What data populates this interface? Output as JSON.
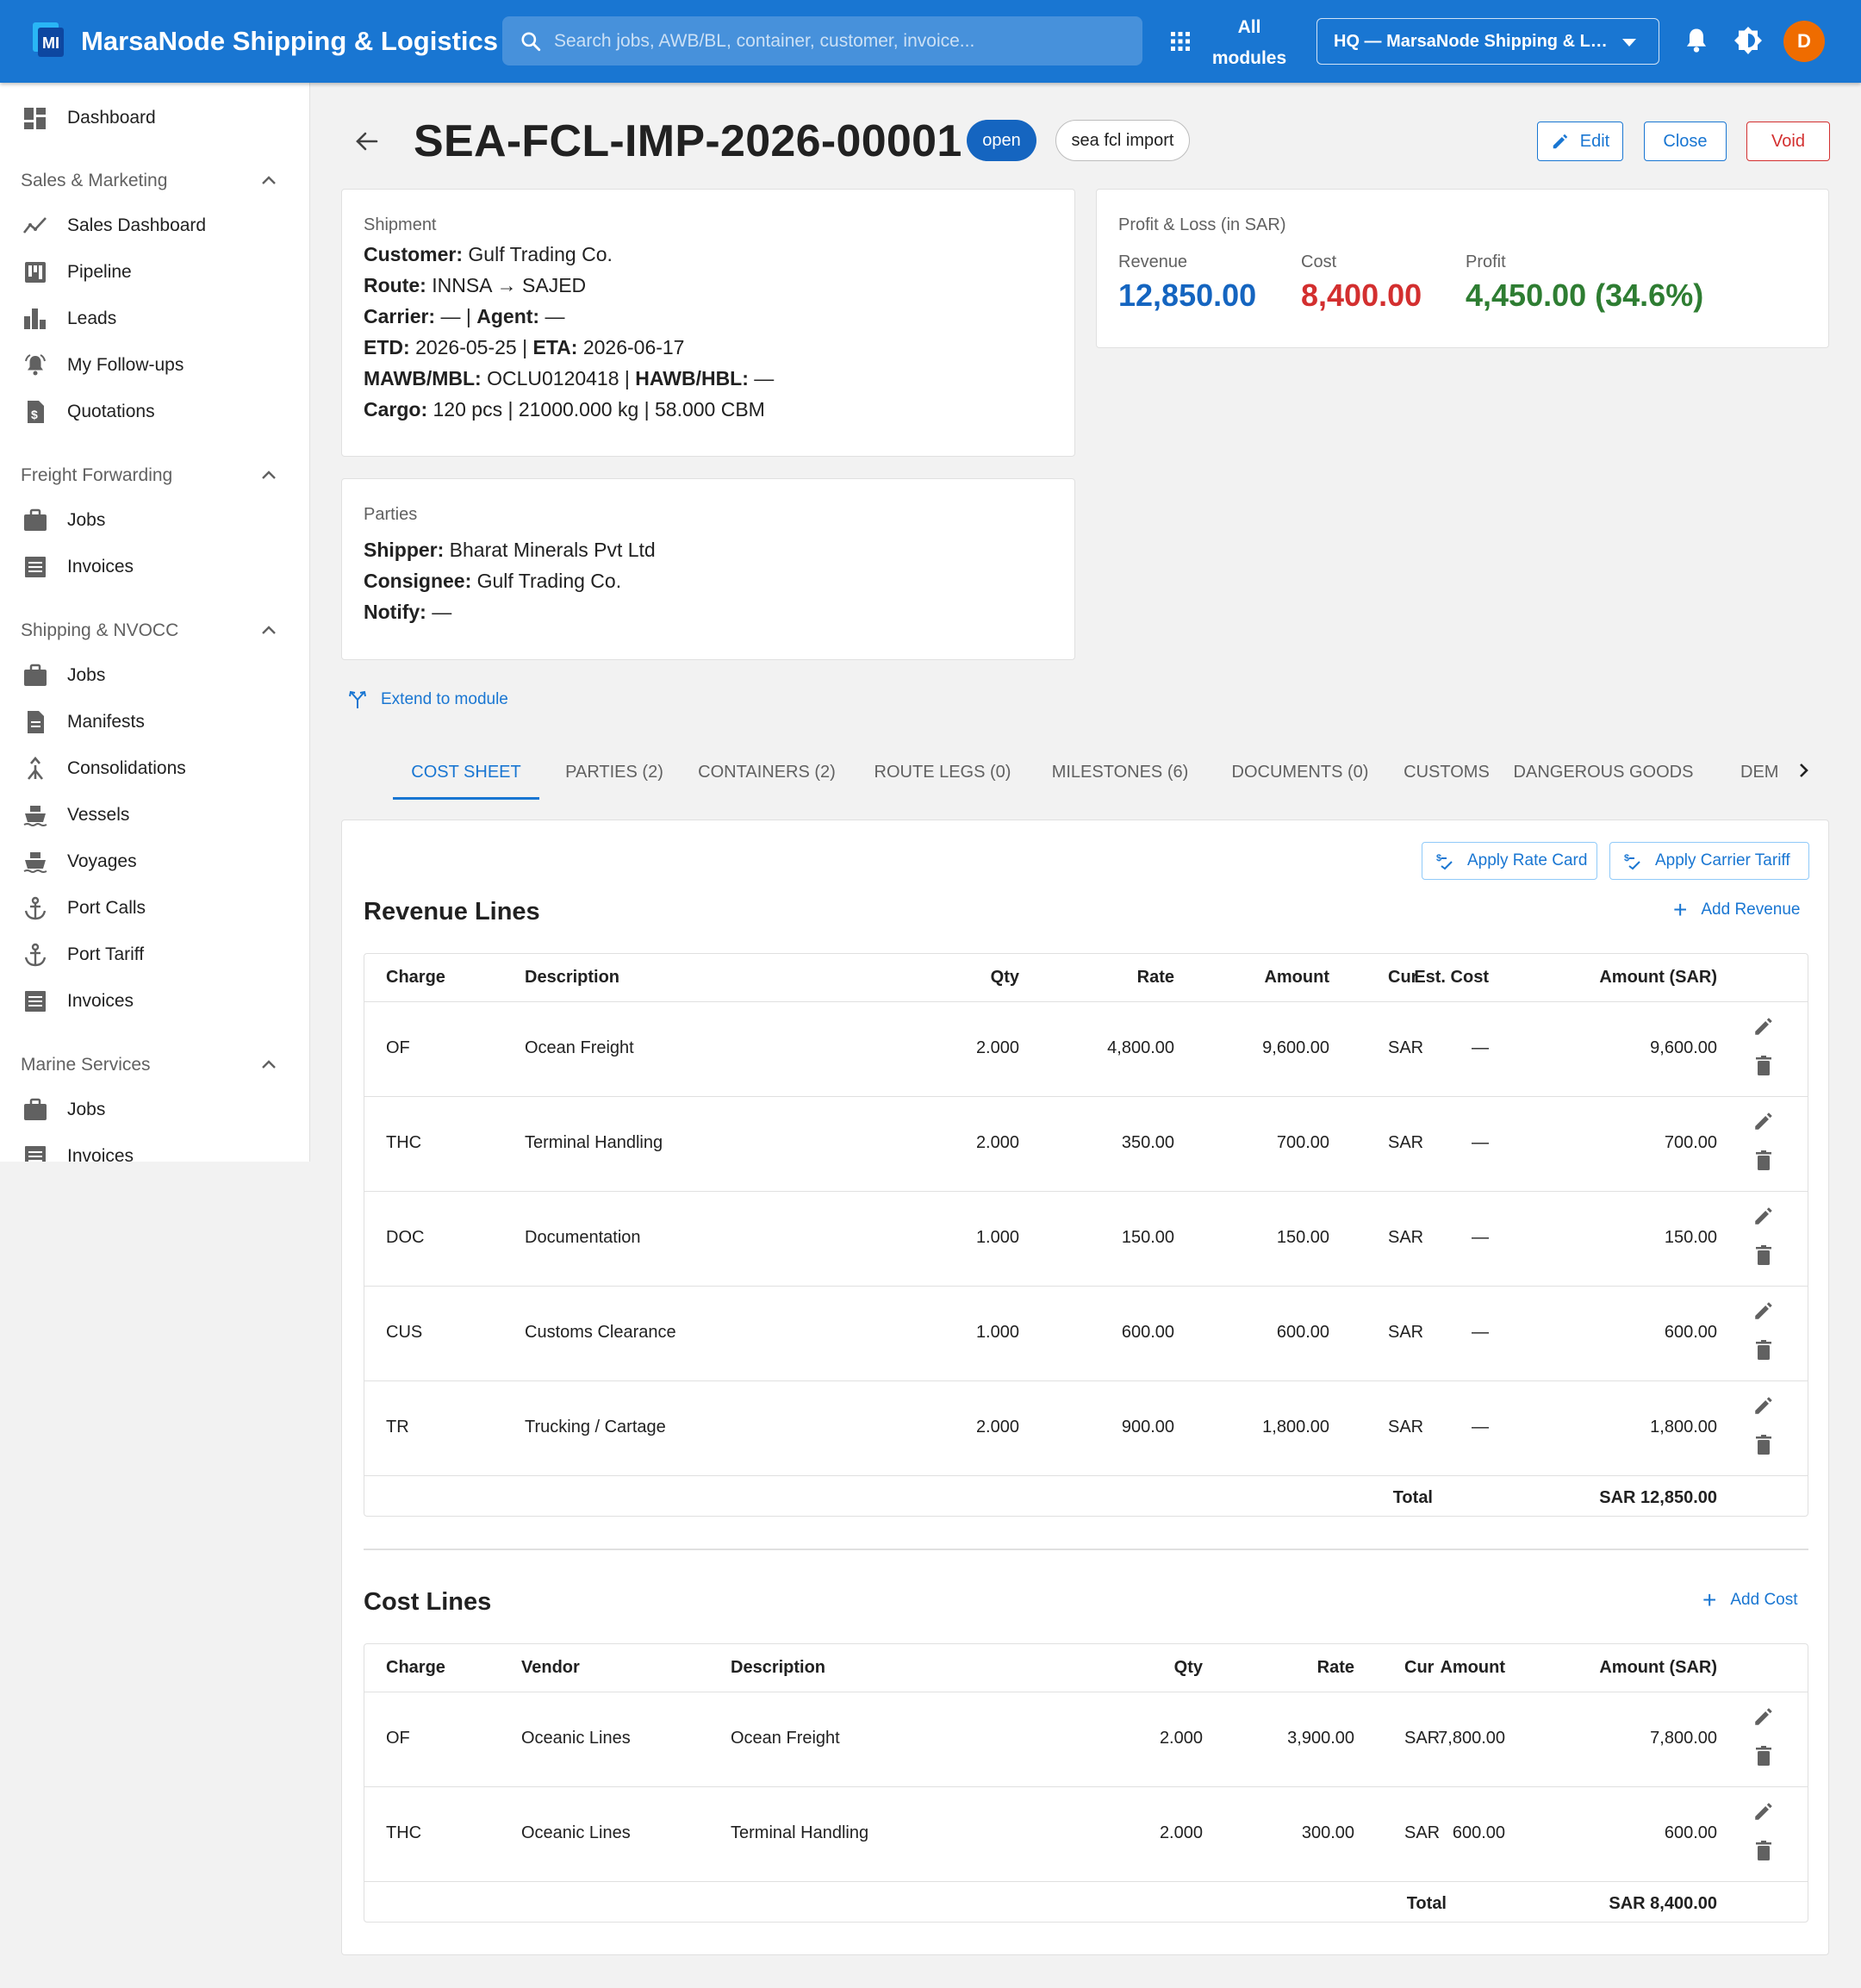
{
  "app": {
    "title": "MarsaNode Shipping & Logistics",
    "search_placeholder": "Search jobs, AWB/BL, container, customer, invoice...",
    "all_modules_line1": "All",
    "all_modules_line2": "modules",
    "org_selected": "HQ — MarsaNode Shipping & Logistics",
    "avatar_initial": "D",
    "accent_color": "#1976d2"
  },
  "sidebar": {
    "dashboard": "Dashboard",
    "sections": [
      {
        "title": "Sales & Marketing",
        "items": [
          "Sales Dashboard",
          "Pipeline",
          "Leads",
          "My Follow-ups",
          "Quotations"
        ]
      },
      {
        "title": "Freight Forwarding",
        "items": [
          "Jobs",
          "Invoices"
        ]
      },
      {
        "title": "Shipping & NVOCC",
        "items": [
          "Jobs",
          "Manifests",
          "Consolidations",
          "Vessels",
          "Voyages",
          "Port Calls",
          "Port Tariff",
          "Invoices"
        ]
      },
      {
        "title": "Marine Services",
        "items": [
          "Jobs",
          "Invoices"
        ]
      }
    ]
  },
  "header": {
    "job_number": "SEA-FCL-IMP-2026-00001",
    "status": "open",
    "job_type": "sea fcl import",
    "edit_label": "Edit",
    "close_label": "Close",
    "void_label": "Void"
  },
  "shipment": {
    "title": "Shipment",
    "customer_label": "Customer:",
    "customer": "Gulf Trading Co.",
    "route_label": "Route:",
    "route": "INNSA → SAJED",
    "carrier_label": "Carrier:",
    "carrier": "—",
    "agent_label": "Agent:",
    "agent": "—",
    "etd_label": "ETD:",
    "etd": "2026-05-25",
    "eta_label": "ETA:",
    "eta": "2026-06-17",
    "mbl_label": "MAWB/MBL:",
    "mbl": "OCLU0120418",
    "hbl_label": "HAWB/HBL:",
    "hbl": "—",
    "cargo_label": "Cargo:",
    "cargo": "120 pcs | 21000.000 kg | 58.000 CBM"
  },
  "parties": {
    "title": "Parties",
    "shipper_label": "Shipper:",
    "shipper": "Bharat Minerals Pvt Ltd",
    "consignee_label": "Consignee:",
    "consignee": "Gulf Trading Co.",
    "notify_label": "Notify:",
    "notify": "—"
  },
  "pnl": {
    "title": "Profit & Loss (in SAR)",
    "revenue_label": "Revenue",
    "revenue": "12,850.00",
    "cost_label": "Cost",
    "cost": "8,400.00",
    "profit_label": "Profit",
    "profit": "4,450.00 (34.6%)",
    "colors": {
      "revenue": "#1565c0",
      "cost": "#d32f2f",
      "profit": "#2e7d32"
    }
  },
  "extend_label": "Extend to module",
  "tabs": [
    "COST SHEET",
    "PARTIES (2)",
    "CONTAINERS (2)",
    "ROUTE LEGS (0)",
    "MILESTONES (6)",
    "DOCUMENTS (0)",
    "CUSTOMS",
    "DANGEROUS GOODS",
    "DEM"
  ],
  "active_tab": "COST SHEET",
  "cost_sheet": {
    "apply_rate_card": "Apply Rate Card",
    "apply_carrier_tariff": "Apply Carrier Tariff",
    "revenue": {
      "title": "Revenue Lines",
      "add_label": "Add Revenue",
      "headers": [
        "Charge",
        "Description",
        "Qty",
        "Rate",
        "Amount",
        "Est. Cost",
        "Cur",
        "Amount (SAR)"
      ],
      "rows": [
        [
          "OF",
          "Ocean Freight",
          "2.000",
          "4,800.00",
          "9,600.00",
          "—",
          "SAR",
          "9,600.00"
        ],
        [
          "THC",
          "Terminal Handling",
          "2.000",
          "350.00",
          "700.00",
          "—",
          "SAR",
          "700.00"
        ],
        [
          "DOC",
          "Documentation",
          "1.000",
          "150.00",
          "150.00",
          "—",
          "SAR",
          "150.00"
        ],
        [
          "CUS",
          "Customs Clearance",
          "1.000",
          "600.00",
          "600.00",
          "—",
          "SAR",
          "600.00"
        ],
        [
          "TR",
          "Trucking / Cartage",
          "2.000",
          "900.00",
          "1,800.00",
          "—",
          "SAR",
          "1,800.00"
        ]
      ],
      "total_label": "Total",
      "total_value": "SAR 12,850.00"
    },
    "cost": {
      "title": "Cost Lines",
      "add_label": "Add Cost",
      "headers": [
        "Charge",
        "Vendor",
        "Description",
        "Qty",
        "Rate",
        "Amount",
        "Cur",
        "Amount (SAR)"
      ],
      "rows": [
        [
          "OF",
          "Oceanic Lines",
          "Ocean Freight",
          "2.000",
          "3,900.00",
          "7,800.00",
          "SAR",
          "7,800.00"
        ],
        [
          "THC",
          "Oceanic Lines",
          "Terminal Handling",
          "2.000",
          "300.00",
          "600.00",
          "SAR",
          "600.00"
        ]
      ],
      "total_label": "Total",
      "total_value": "SAR 8,400.00"
    }
  }
}
